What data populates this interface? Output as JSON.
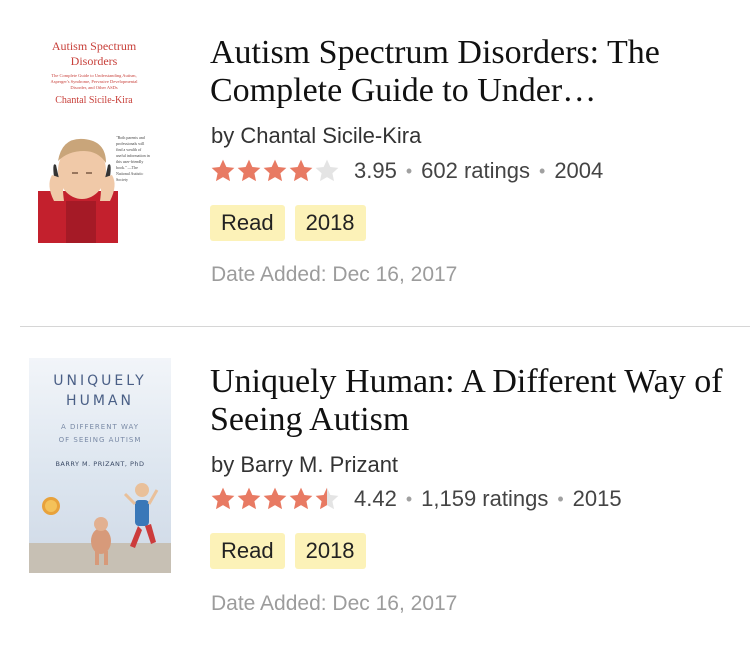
{
  "books": [
    {
      "title": "Autism Spectrum Disorders: The Complete Guide to Under…",
      "author": "by Chantal Sicile-Kira",
      "rating": "3.95",
      "rating_value": 3.95,
      "ratings_count": "602 ratings",
      "year": "2004",
      "shelves": [
        "Read",
        "2018"
      ],
      "date_added": "Date Added: Dec 16, 2017",
      "cover": {
        "title": "Autism Spectrum Disorders",
        "subtitle": "The Complete Guide to Understanding Autism, Asperger's Syndrome, Pervasive Developmental Disorder, and Other ASDs",
        "author": "Chantal Sicile-Kira",
        "quote": "\"Both parents and professionals will find a wealth of useful information in this user-friendly book.\" —The National Autistic Society"
      }
    },
    {
      "title": "Uniquely Human: A Different Way of Seeing Autism",
      "author": "by Barry M. Prizant",
      "rating": "4.42",
      "rating_value": 4.42,
      "ratings_count": "1,159 ratings",
      "year": "2015",
      "shelves": [
        "Read",
        "2018"
      ],
      "date_added": "Date Added: Dec 16, 2017",
      "cover": {
        "title_line1": "UNIQUELY",
        "title_line2": "HUMAN",
        "subtitle_line1": "A DIFFERENT WAY",
        "subtitle_line2": "OF SEEING AUTISM",
        "author": "BARRY M. PRIZANT, PhD"
      }
    }
  ],
  "colors": {
    "star_filled": "#e87a63",
    "star_empty": "#e4e4e4",
    "tag_background": "#fcf2b8",
    "divider": "#d6d6d6",
    "date_text": "#9c9c9c"
  }
}
